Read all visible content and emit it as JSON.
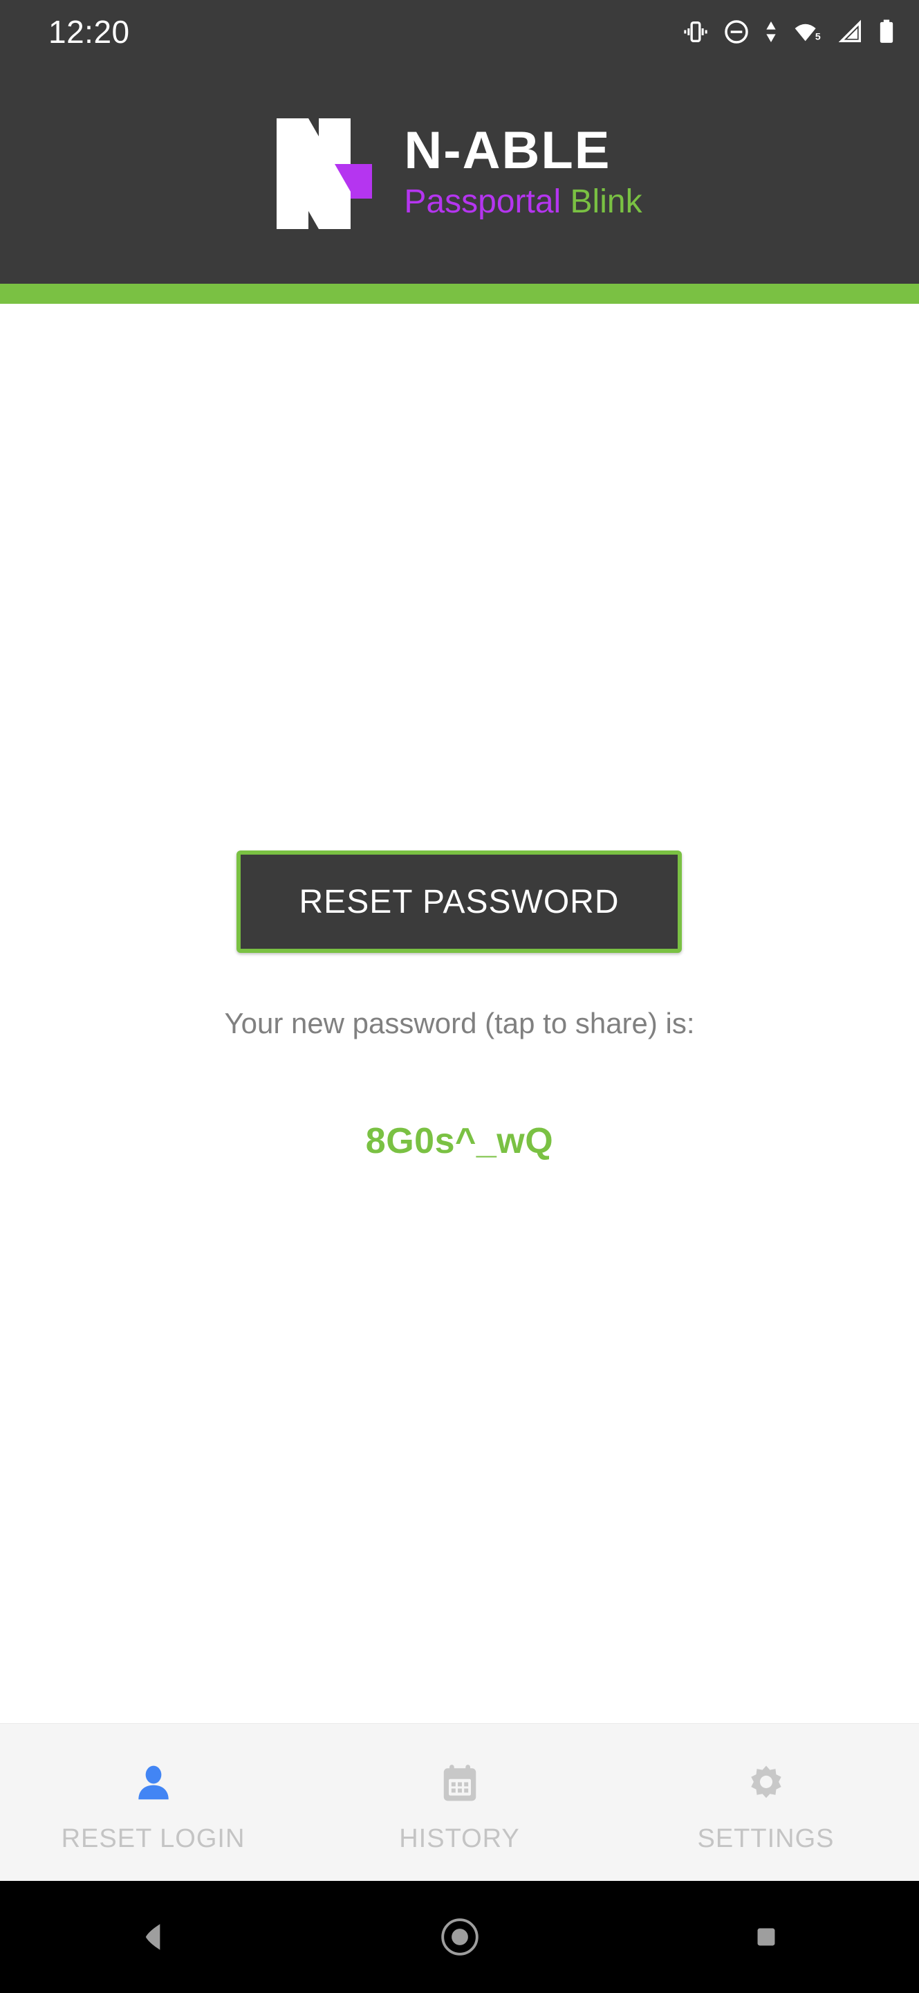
{
  "status_bar": {
    "clock": "12:20",
    "icons": [
      {
        "name": "vibrate-icon",
        "label": "Vibrate"
      },
      {
        "name": "do-not-disturb-icon",
        "label": "Do not disturb"
      },
      {
        "name": "data-transfer-icon",
        "label": "Data transfer"
      },
      {
        "name": "wifi-icon",
        "label": "Wi-Fi",
        "badge": "5"
      },
      {
        "name": "cellular-signal-icon",
        "label": "Cellular signal"
      },
      {
        "name": "battery-icon",
        "label": "Battery"
      }
    ]
  },
  "header": {
    "logo_mark_name": "n-able-logo-mark",
    "title": "N-ABLE",
    "subtitle_primary": "Passportal",
    "subtitle_secondary": "Blink",
    "background_color": "#3b3b3b",
    "accent_bar_color": "#7ac143"
  },
  "main": {
    "reset_button_label": "RESET PASSWORD",
    "password_caption": "Your new password (tap to share) is:",
    "password_value": "8G0s^_wQ",
    "password_color": "#7ac143",
    "button_background": "#3b3b3b",
    "button_border_color": "#7ac143"
  },
  "tabs": [
    {
      "label": "RESET LOGIN",
      "icon": "person-icon",
      "active": true,
      "icon_color": "#4285f4"
    },
    {
      "label": "HISTORY",
      "icon": "calendar-icon",
      "active": false,
      "icon_color": "#c8c8c8"
    },
    {
      "label": "SETTINGS",
      "icon": "gear-icon",
      "active": false,
      "icon_color": "#c8c8c8"
    }
  ],
  "nav_bar": {
    "back_label": "Back",
    "home_label": "Home",
    "recents_label": "Recent apps"
  }
}
